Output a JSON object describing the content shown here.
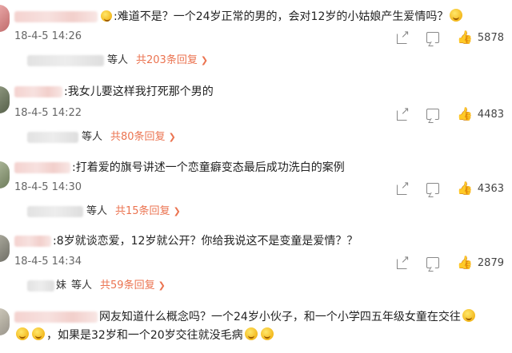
{
  "comments": [
    {
      "text": ":难道不是？一个24岁正常的男的，会对12岁的小姑娘产生爱情吗？",
      "time": "18-4-5 14:26",
      "likes": "5878",
      "replies": {
        "label": "等人",
        "count_text": "共203条回复"
      }
    },
    {
      "text": ":我女儿要这样我打死那个男的",
      "time": "18-4-5 14:22",
      "likes": "4483",
      "replies": {
        "label": "等人",
        "count_text": "共80条回复"
      }
    },
    {
      "text": ":打着爱的旗号讲述一个恋童癖变态最后成功洗白的案例",
      "time": "18-4-5 14:30",
      "likes": "4363",
      "replies": {
        "label": "等人",
        "count_text": "共15条回复"
      }
    },
    {
      "text": ":8岁就谈恋爱，12岁就公开？你给我说这不是变童是爱情？？",
      "time": "18-4-5 14:34",
      "likes": "2879",
      "replies": {
        "name_tail": "妹",
        "label": "等人",
        "count_text": "共59条回复"
      }
    },
    {
      "text": "网友知道什么概念吗？一个24岁小伙子，和一个小学四五年级女童在交往",
      "text2": "，如果是32岁和一个20岁交往就没毛病"
    }
  ]
}
